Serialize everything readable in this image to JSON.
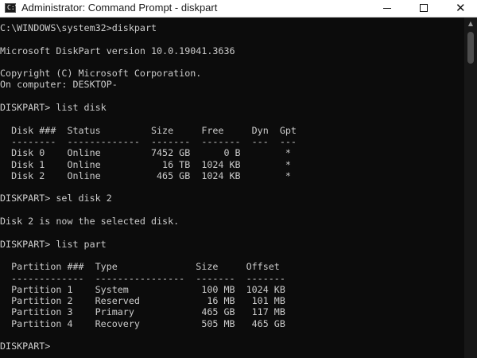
{
  "window": {
    "title": "Administrator: Command Prompt - diskpart",
    "app_icon_glyph": "C:\\",
    "icons": [
      "console-app-icon",
      "minimize-icon",
      "maximize-icon",
      "close-icon"
    ]
  },
  "console": {
    "lines": [
      "C:\\WINDOWS\\system32>diskpart",
      "",
      "Microsoft DiskPart version 10.0.19041.3636",
      "",
      "Copyright (C) Microsoft Corporation.",
      "On computer: DESKTOP-",
      "",
      "DISKPART> list disk",
      "",
      "  Disk ###  Status         Size     Free     Dyn  Gpt",
      "  --------  -------------  -------  -------  ---  ---",
      "  Disk 0    Online         7452 GB      0 B        *",
      "  Disk 1    Online           16 TB  1024 KB        *",
      "  Disk 2    Online          465 GB  1024 KB        *",
      "",
      "DISKPART> sel disk 2",
      "",
      "Disk 2 is now the selected disk.",
      "",
      "DISKPART> list part",
      "",
      "  Partition ###  Type              Size     Offset",
      "  -------------  ----------------  -------  -------",
      "  Partition 1    System             100 MB  1024 KB",
      "  Partition 2    Reserved            16 MB   101 MB",
      "  Partition 3    Primary            465 GB   117 MB",
      "  Partition 4    Recovery           505 MB   465 GB",
      "",
      "DISKPART>"
    ]
  },
  "colors": {
    "console_background": "#0c0c0c",
    "console_text": "#cccccc",
    "titlebar_background": "#ffffff"
  }
}
